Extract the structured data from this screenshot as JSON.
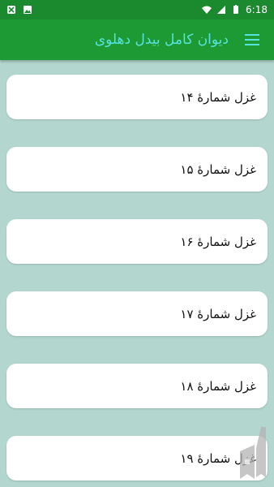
{
  "status_bar": {
    "time": "6:18",
    "left_icons": [
      "settings-badge-icon",
      "image-icon"
    ],
    "right_icons": [
      "wifi-icon",
      "signal-icon",
      "battery-icon"
    ]
  },
  "app_bar": {
    "title": "دیوان کامل بیدل دهلوی",
    "menu_icon": "menu-icon"
  },
  "items": [
    {
      "label": "غزل شمارهٔ ۱۴"
    },
    {
      "label": "غزل شمارهٔ ۱۵"
    },
    {
      "label": "غزل شمارهٔ ۱۶"
    },
    {
      "label": "غزل شمارهٔ ۱۷"
    },
    {
      "label": "غزل شمارهٔ ۱۸"
    },
    {
      "label": "غزل شمارهٔ ۱۹"
    }
  ],
  "colors": {
    "status_bar": "#1b8a2e",
    "app_bar": "#1e9a34",
    "title_text": "#57e3dd",
    "background": "#b3d7cf",
    "card": "#ffffff"
  }
}
